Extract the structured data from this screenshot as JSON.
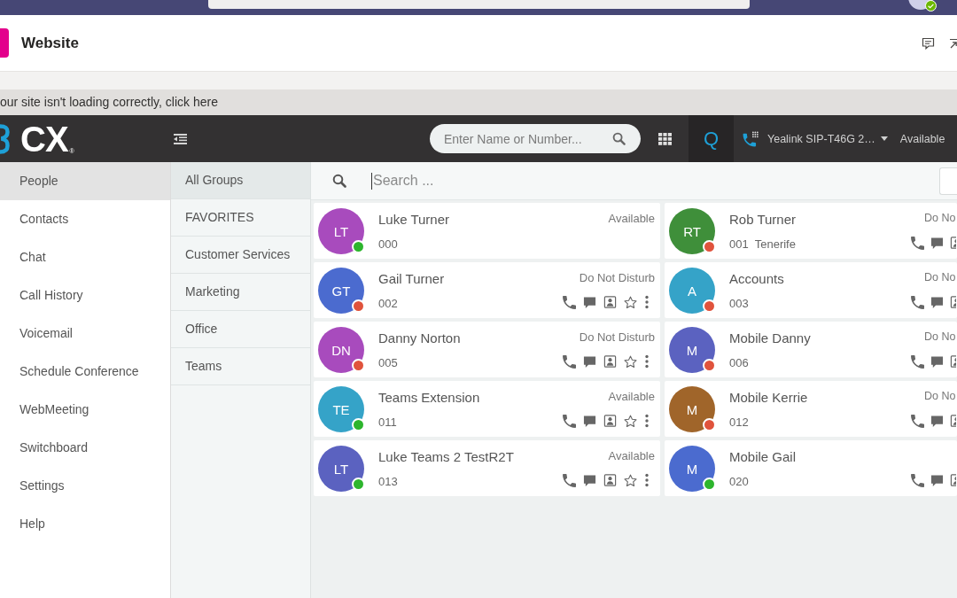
{
  "teams_bar": {
    "avatar_badge": {
      "color": "#6bb700"
    }
  },
  "tab": {
    "title": "Website"
  },
  "banner": {
    "text": "our site isn't loading correctly, click here"
  },
  "app_header": {
    "logo": {
      "text": "CX",
      "mark": "®"
    },
    "dial_search": {
      "placeholder": "Enter Name or Number..."
    },
    "queue_button": "Q",
    "phone": {
      "device": "Yealink SIP-T46G 2…",
      "status": "Available"
    }
  },
  "nav": {
    "items": [
      {
        "label": "People",
        "selected": true
      },
      {
        "label": "Contacts",
        "selected": false
      },
      {
        "label": "Chat",
        "selected": false
      },
      {
        "label": "Call History",
        "selected": false
      },
      {
        "label": "Voicemail",
        "selected": false
      },
      {
        "label": "Schedule Conference",
        "selected": false
      },
      {
        "label": "WebMeeting",
        "selected": false
      },
      {
        "label": "Switchboard",
        "selected": false
      },
      {
        "label": "Settings",
        "selected": false
      },
      {
        "label": "Help",
        "selected": false
      }
    ]
  },
  "groups": {
    "items": [
      {
        "label": "All Groups",
        "selected": true
      },
      {
        "label": "FAVORITES",
        "selected": false
      },
      {
        "label": "Customer Services",
        "selected": false
      },
      {
        "label": "Marketing",
        "selected": false
      },
      {
        "label": "Office",
        "selected": false
      },
      {
        "label": "Teams",
        "selected": false
      }
    ]
  },
  "contact_search": {
    "placeholder": "Search ..."
  },
  "contacts": [
    {
      "name": "Luke Turner",
      "extension": "000",
      "status": "Available",
      "kind": "self",
      "avatar": {
        "initials": "LT",
        "color": "#a84bbd"
      },
      "dot": {
        "color": "#2db52d"
      }
    },
    {
      "name": "Rob Turner",
      "extension": "001",
      "location": "Tenerife",
      "status": "Do No",
      "kind": "contact",
      "avatar": {
        "initials": "RT",
        "color": "#3f8f3a"
      },
      "dot": {
        "color": "#e0533c"
      }
    },
    {
      "name": "Gail Turner",
      "extension": "002",
      "status": "Do Not Disturb",
      "kind": "contact",
      "favorite": false,
      "avatar": {
        "initials": "GT",
        "color": "#4b6bcf"
      },
      "dot": {
        "color": "#e0533c"
      }
    },
    {
      "name": "Accounts",
      "extension": "003",
      "status": "Do No",
      "kind": "contact",
      "avatar": {
        "initials": "A",
        "color": "#35a3c8"
      },
      "dot": {
        "color": "#e0533c"
      }
    },
    {
      "name": "Danny Norton",
      "extension": "005",
      "status": "Do Not Disturb",
      "kind": "contact",
      "favorite": false,
      "avatar": {
        "initials": "DN",
        "color": "#a84bbd"
      },
      "dot": {
        "color": "#e0533c"
      }
    },
    {
      "name": "Mobile Danny",
      "extension": "006",
      "status": "Do No",
      "kind": "contact",
      "avatar": {
        "initials": "M",
        "color": "#5b62c0"
      },
      "dot": {
        "color": "#e0533c"
      }
    },
    {
      "name": "Teams Extension",
      "extension": "011",
      "status": "Available",
      "kind": "contact",
      "favorite": false,
      "avatar": {
        "initials": "TE",
        "color": "#35a3c8"
      },
      "dot": {
        "color": "#2db52d"
      }
    },
    {
      "name": "Mobile Kerrie",
      "extension": "012",
      "status": "Do No",
      "kind": "contact",
      "avatar": {
        "initials": "M",
        "color": "#a0652a"
      },
      "dot": {
        "color": "#e0533c"
      }
    },
    {
      "name": "Luke Teams 2 TestR2T",
      "extension": "013",
      "status": "Available",
      "kind": "contact",
      "favorite": false,
      "avatar": {
        "initials": "LT",
        "color": "#5b62c0"
      },
      "dot": {
        "color": "#2db52d"
      }
    },
    {
      "name": "Mobile Gail",
      "extension": "020",
      "kind": "contact",
      "avatar": {
        "initials": "M",
        "color": "#4b6bcf"
      },
      "dot": {
        "color": "#2db52d"
      }
    }
  ]
}
